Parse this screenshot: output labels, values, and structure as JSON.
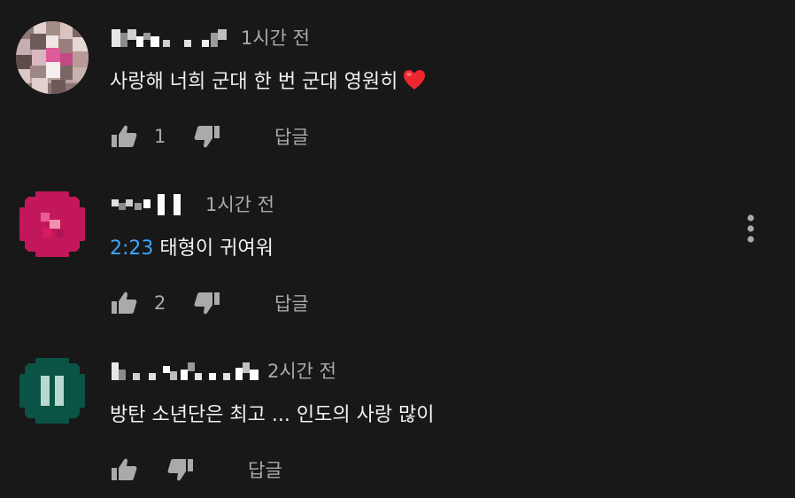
{
  "comments": [
    {
      "avatar": "pixelated-photo-avatar",
      "author": "",
      "time": "1시간 전",
      "text": "사랑해 너희 군대 한 번 군대 영원히",
      "emoji": "❤️",
      "likes": "1",
      "reply_label": "답글"
    },
    {
      "avatar": "pink-circle-avatar",
      "author": "",
      "time": "1시간 전",
      "timestamp": "2:23",
      "text": " 태형이 귀여워",
      "likes": "2",
      "reply_label": "답글",
      "menu_icon": "more-vertical-icon"
    },
    {
      "avatar": "green-circle-avatar",
      "author": "",
      "time": "2시간 전",
      "text": "방탄 소년단은 최고 ... 인도의 사랑 많이",
      "likes": "",
      "reply_label": "답글"
    }
  ],
  "colors": {
    "background": "#181818",
    "text": "#f1f1f1",
    "secondary": "#aaaaaa",
    "link": "#3ea6ff"
  }
}
